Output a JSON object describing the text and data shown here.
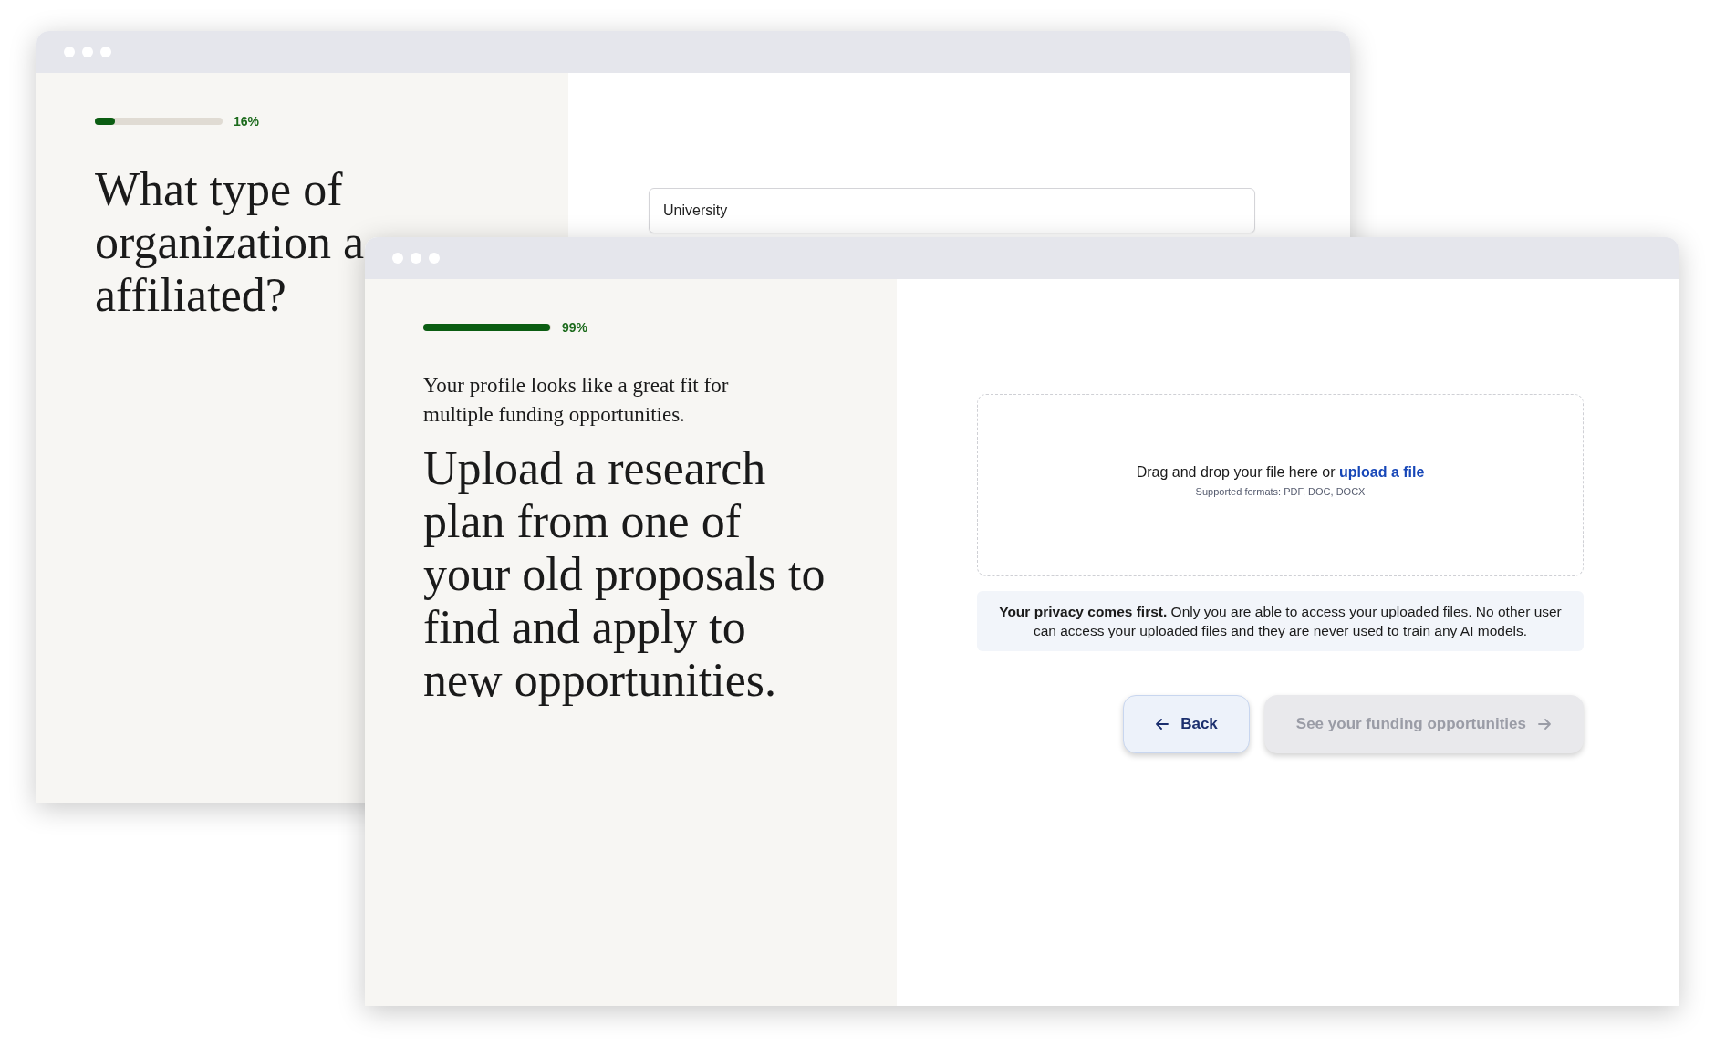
{
  "windows": [
    {
      "kind": "question",
      "progress": {
        "level": 0.16,
        "reading": "16%"
      },
      "heading_lines": [
        "What type of",
        "organization a",
        "affiliated?"
      ],
      "field": {
        "value": "University"
      }
    },
    {
      "kind": "upload",
      "progress": {
        "level": 0.99,
        "reading": "99%"
      },
      "intro": "Your profile looks like a great fit for multiple funding opportunities.",
      "heading": "Upload a research plan from one of your old proposals to find and apply to new opportunities.",
      "dropzone": {
        "prompt": "Drag and drop your file here or",
        "link": "upload a file",
        "formats": "Supported formats: PDF, DOC, DOCX"
      },
      "privacy_note": "**Your privacy comes first.** Only you are able to access your uploaded files. No other user can access your uploaded files and they are never used to train any AI models.",
      "buttons": [
        {
          "kind": "back",
          "label": "Back",
          "disabled": false
        },
        {
          "kind": "next",
          "label": "See your funding opportunities",
          "disabled": true
        }
      ]
    }
  ]
}
